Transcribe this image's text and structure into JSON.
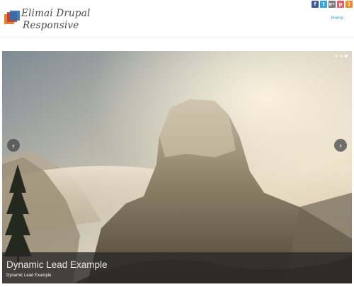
{
  "site": {
    "title_line1": "Elimai Drupal",
    "title_line2": "Responsive"
  },
  "nav": {
    "home_label": "Home"
  },
  "social": [
    {
      "icon": "facebook-icon",
      "glyph": "f",
      "color": "#3b5998"
    },
    {
      "icon": "twitter-icon",
      "glyph": "t",
      "color": "#2fa8e0"
    },
    {
      "icon": "google-plus-icon",
      "glyph": "g+",
      "color": "#7b7b7b"
    },
    {
      "icon": "pinterest-icon",
      "glyph": "p",
      "color": "#e75b6b"
    },
    {
      "icon": "rss-icon",
      "glyph": ")",
      "color": "#f08a2c"
    }
  ],
  "slider": {
    "caption_title": "Dynamic Lead Example",
    "caption_subtitle": "Dynamic Lead Example",
    "prev_icon": "‹",
    "next_icon": "›",
    "dots_total": 3,
    "active_dot": 3
  },
  "colors": {
    "accent": "#2aa0d6"
  }
}
